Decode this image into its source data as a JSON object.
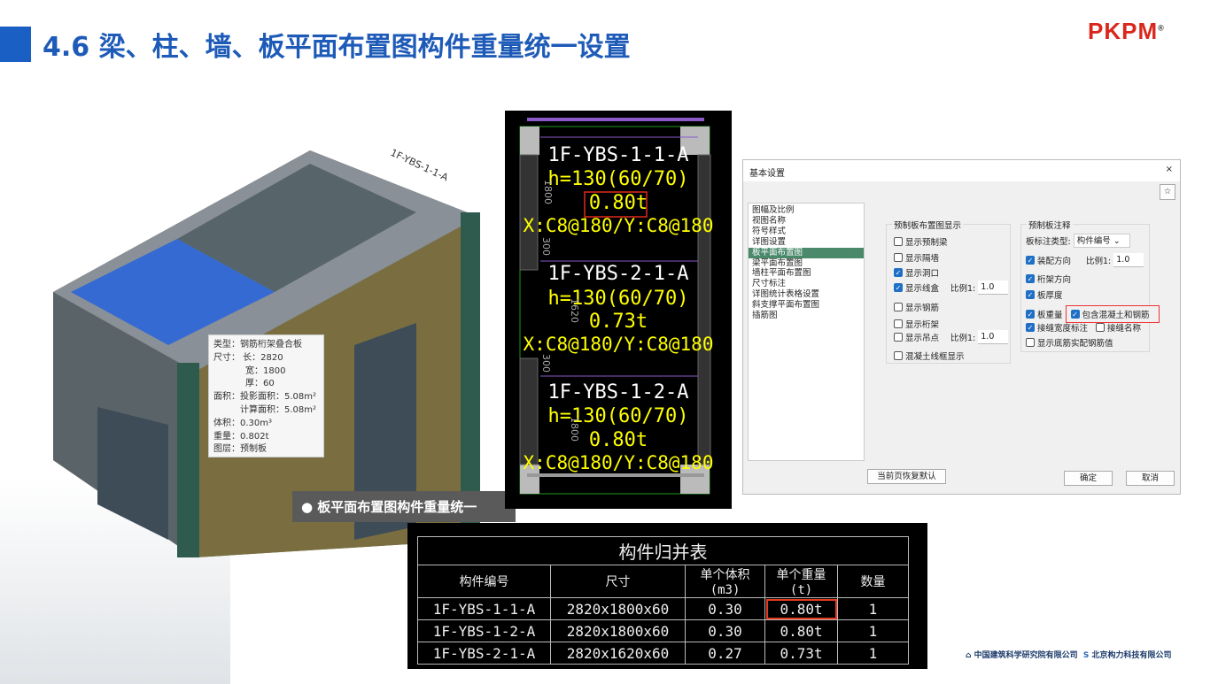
{
  "header": {
    "title": "4.6 梁、柱、墙、板平面布置图构件重量统一设置",
    "logo": "PKPM",
    "logo_mark": "®"
  },
  "tooltip": {
    "type": "类型：钢筋桁架叠合板",
    "size": "尺寸：  长：2820",
    "width": "宽：1800",
    "thick": "厚：60",
    "area": "面积：投影面积：5.08m²",
    "calc_area": "计算面积：5.08m²",
    "volume": "体积：0.30m³",
    "weight": "重量：0.802t",
    "layer": "图层：预制板"
  },
  "model": {
    "label": "1F-YBS-1-1-A"
  },
  "caption": "● 板平面布置图构件重量统一",
  "cad": {
    "panels": [
      {
        "id": "1F-YBS-1-1-A",
        "h": "h=130(60/70)",
        "weight": "0.80t",
        "rebar": "X:C8@180/Y:C8@180"
      },
      {
        "id": "1F-YBS-2-1-A",
        "h": "h=130(60/70)",
        "weight": "0.73t",
        "rebar": "X:C8@180/Y:C8@180"
      },
      {
        "id": "1F-YBS-1-2-A",
        "h": "h=130(60/70)",
        "weight": "0.80t",
        "rebar": "X:C8@180/Y:C8@180"
      }
    ],
    "dims": [
      "1800",
      "300",
      "1620",
      "300",
      "1800"
    ]
  },
  "dialog": {
    "title": "基本设置",
    "close": "×",
    "star": "☆",
    "nav": [
      "图幅及比例",
      "视图名称",
      "符号样式",
      "详图设置",
      "板平面布置图",
      "梁平面布置图",
      "墙柱平面布置图",
      "尺寸标注",
      "详图统计表格设置",
      "斜支撑平面布置图",
      "插筋图"
    ],
    "group1": {
      "legend": "预制板布置图显示",
      "items": [
        {
          "label": "显示预制梁",
          "checked": false
        },
        {
          "label": "显示隔墙",
          "checked": false
        },
        {
          "label": "显示洞口",
          "checked": true
        },
        {
          "label": "显示线盒",
          "checked": true,
          "scale_label": "比例1:",
          "scale": "1.0"
        },
        {
          "label": "显示钢筋",
          "checked": false
        },
        {
          "label": "显示桁架",
          "checked": false
        },
        {
          "label": "显示吊点",
          "checked": false,
          "scale_label": "比例1:",
          "scale": "1.0"
        },
        {
          "label": "混凝土线框显示",
          "checked": false
        }
      ]
    },
    "group2": {
      "legend": "预制板注释",
      "type_label": "板标注类型:",
      "type_value": "构件编号",
      "assembly": "装配方向",
      "assembly_scale_label": "比例1:",
      "assembly_scale": "1.0",
      "truss": "桁架方向",
      "thickness": "板厚度",
      "weight": "板重量",
      "include": "包含混凝土和钢筋",
      "seam_width": "接缝宽度标注",
      "seam_name": "接缝名称",
      "bottom_rebar": "显示底筋实配钢筋值"
    },
    "reset": "当前页恢复默认",
    "ok": "确定",
    "cancel": "取消"
  },
  "table": {
    "title": "构件归并表",
    "headers": [
      "构件编号",
      "尺寸",
      "单个体积(m3)",
      "单个重量(t)",
      "数量"
    ],
    "rows": [
      [
        "1F-YBS-1-1-A",
        "2820x1800x60",
        "0.30",
        "0.80t",
        "1"
      ],
      [
        "1F-YBS-1-2-A",
        "2820x1800x60",
        "0.30",
        "0.80t",
        "1"
      ],
      [
        "1F-YBS-2-1-A",
        "2820x1620x60",
        "0.27",
        "0.73t",
        "1"
      ]
    ]
  },
  "footer": {
    "org1": "中国建筑科学研究院有限公司",
    "org2": "北京构力科技有限公司"
  }
}
